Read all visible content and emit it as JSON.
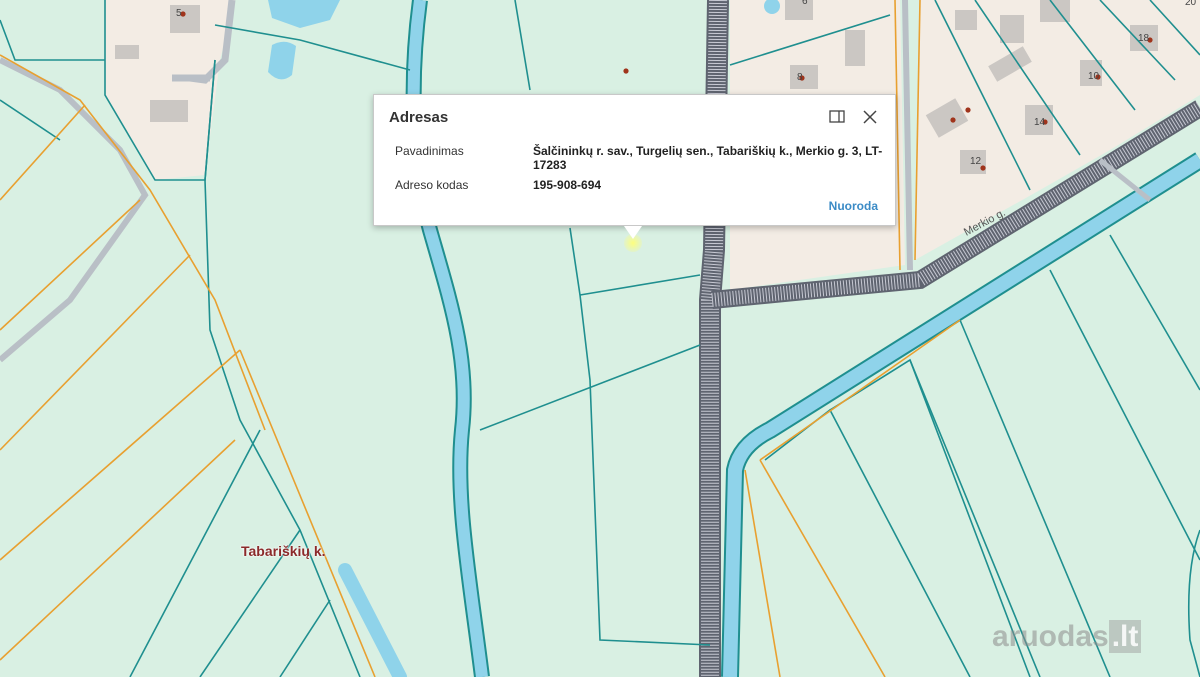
{
  "popup": {
    "title": "Adresas",
    "rows": [
      {
        "label": "Pavadinimas",
        "value": "Šalčininkų r. sav., Turgelių sen., Tabariškių k., Merkio g. 3, LT-17283"
      },
      {
        "label": "Adreso kodas",
        "value": "195-908-694"
      }
    ],
    "link_label": "Nuoroda"
  },
  "map": {
    "place_label": "Tabariškių k.",
    "street_label": "Merkio g.",
    "house_numbers": [
      "5",
      "6",
      "8",
      "10",
      "12",
      "14",
      "18",
      "20"
    ]
  },
  "watermark": {
    "text": "aruodas",
    "suffix": ".lt"
  },
  "icons": {
    "dock": "dock-panel-icon",
    "close": "close-icon"
  },
  "colors": {
    "land": "#d9f0e3",
    "parcel_line": "#1f8f8f",
    "boundary_orange": "#e8a030",
    "water": "#8fd3ea",
    "built_area": "#f3ece4",
    "building": "#c8c6c4",
    "road": "#b8b8c4"
  }
}
